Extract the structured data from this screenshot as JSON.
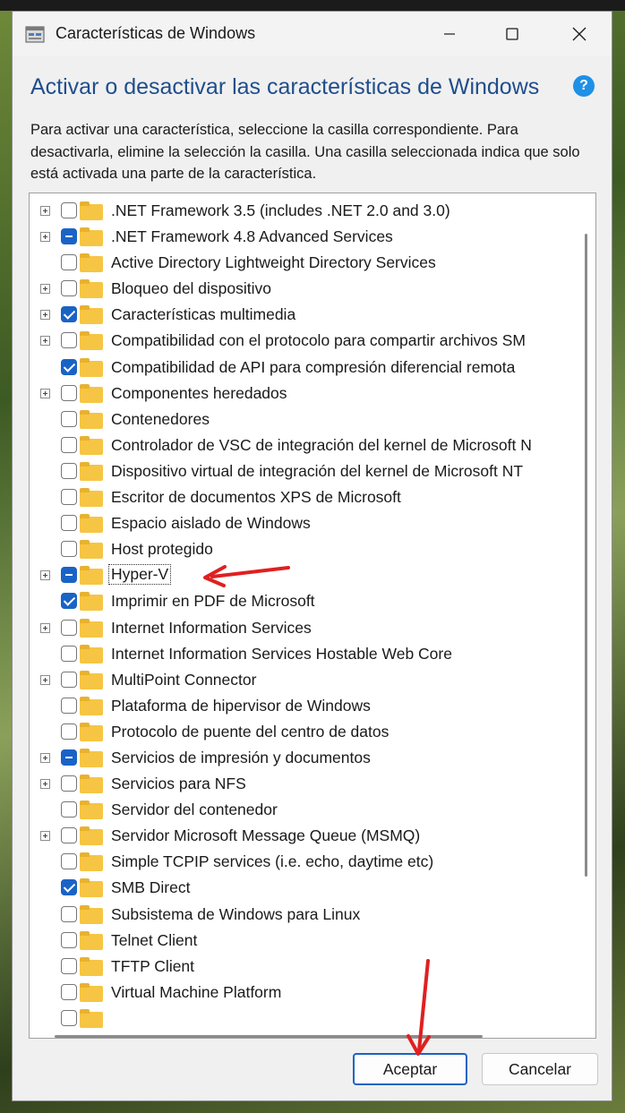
{
  "window": {
    "title": "Características de Windows"
  },
  "heading": "Activar o desactivar las características de Windows",
  "description": "Para activar una característica, seleccione la casilla correspondiente. Para desactivarla, elimine la selección la casilla. Una casilla seleccionada indica que solo está activada una parte de la característica.",
  "features": [
    {
      "label": ".NET Framework 3.5 (includes .NET 2.0 and 3.0)",
      "expandable": true,
      "state": "unchecked"
    },
    {
      "label": ".NET Framework 4.8 Advanced Services",
      "expandable": true,
      "state": "partial"
    },
    {
      "label": "Active Directory Lightweight Directory Services",
      "expandable": false,
      "state": "unchecked"
    },
    {
      "label": "Bloqueo del dispositivo",
      "expandable": true,
      "state": "unchecked"
    },
    {
      "label": "Características multimedia",
      "expandable": true,
      "state": "checked"
    },
    {
      "label": "Compatibilidad con el protocolo para compartir archivos SM",
      "expandable": true,
      "state": "unchecked"
    },
    {
      "label": "Compatibilidad de API para compresión diferencial remota",
      "expandable": false,
      "state": "checked"
    },
    {
      "label": "Componentes heredados",
      "expandable": true,
      "state": "unchecked"
    },
    {
      "label": "Contenedores",
      "expandable": false,
      "state": "unchecked"
    },
    {
      "label": "Controlador de VSC de integración del kernel de Microsoft N",
      "expandable": false,
      "state": "unchecked"
    },
    {
      "label": "Dispositivo virtual de integración del kernel de Microsoft NT",
      "expandable": false,
      "state": "unchecked"
    },
    {
      "label": "Escritor de documentos XPS de Microsoft",
      "expandable": false,
      "state": "unchecked"
    },
    {
      "label": "Espacio aislado de Windows",
      "expandable": false,
      "state": "unchecked"
    },
    {
      "label": "Host protegido",
      "expandable": false,
      "state": "unchecked"
    },
    {
      "label": "Hyper-V",
      "expandable": true,
      "state": "partial",
      "selected": true
    },
    {
      "label": "Imprimir en PDF de Microsoft",
      "expandable": false,
      "state": "checked"
    },
    {
      "label": "Internet Information Services",
      "expandable": true,
      "state": "unchecked"
    },
    {
      "label": "Internet Information Services Hostable Web Core",
      "expandable": false,
      "state": "unchecked"
    },
    {
      "label": "MultiPoint Connector",
      "expandable": true,
      "state": "unchecked"
    },
    {
      "label": "Plataforma de hipervisor de Windows",
      "expandable": false,
      "state": "unchecked"
    },
    {
      "label": "Protocolo de puente del centro de datos",
      "expandable": false,
      "state": "unchecked"
    },
    {
      "label": "Servicios de impresión y documentos",
      "expandable": true,
      "state": "partial"
    },
    {
      "label": "Servicios para NFS",
      "expandable": true,
      "state": "unchecked"
    },
    {
      "label": "Servidor del contenedor",
      "expandable": false,
      "state": "unchecked"
    },
    {
      "label": "Servidor Microsoft Message Queue (MSMQ)",
      "expandable": true,
      "state": "unchecked"
    },
    {
      "label": "Simple TCPIP services (i.e. echo, daytime etc)",
      "expandable": false,
      "state": "unchecked"
    },
    {
      "label": "SMB Direct",
      "expandable": false,
      "state": "checked"
    },
    {
      "label": "Subsistema de Windows para Linux",
      "expandable": false,
      "state": "unchecked"
    },
    {
      "label": "Telnet Client",
      "expandable": false,
      "state": "unchecked"
    },
    {
      "label": "TFTP Client",
      "expandable": false,
      "state": "unchecked"
    },
    {
      "label": "Virtual Machine Platform",
      "expandable": false,
      "state": "unchecked"
    },
    {
      "label": "",
      "expandable": false,
      "state": "unchecked"
    }
  ],
  "buttons": {
    "accept": "Aceptar",
    "cancel": "Cancelar"
  },
  "icons": {
    "help": "?",
    "minimize": "minimize-icon",
    "maximize": "maximize-icon",
    "close": "close-icon"
  },
  "colors": {
    "accent": "#1a63c6",
    "heading": "#1f4e8c",
    "annotation_arrow": "#e02020"
  }
}
